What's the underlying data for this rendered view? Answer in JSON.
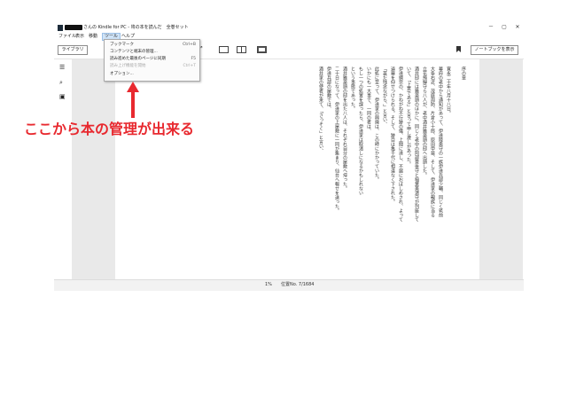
{
  "window": {
    "title": "さんの Kindle for PC - 将の本を読んだ　全巻セット",
    "controls": {
      "minimize": "－",
      "maximize": "▢",
      "close": "✕"
    }
  },
  "menubar": {
    "items": [
      "ファイル",
      "表示",
      "移動",
      "ツール",
      "ヘルプ"
    ],
    "active": "ツール"
  },
  "toolbar": {
    "library_button": "ライブラリ",
    "notebook_button": "ノートブックを表示",
    "view_icons": [
      "single-page-icon",
      "two-page-icon",
      "grid-view-icon"
    ],
    "bookmark_icon": "bookmark-icon"
  },
  "sidebar": {
    "icons": [
      "contents-icon",
      "search-icon",
      "notes-icon"
    ]
  },
  "tools_menu": {
    "items": [
      {
        "label": "ブックマーク",
        "shortcut": "Ctrl+B",
        "enabled": true
      },
      {
        "label": "コンテンツと端末の管理...",
        "shortcut": "",
        "enabled": true
      },
      {
        "label": "読み進めた最後のページに同期",
        "shortcut": "F5",
        "enabled": true
      },
      {
        "label": "読み上げ機能を開始",
        "shortcut": "Ctrl+T",
        "enabled": false
      },
      {
        "label": "オプション...",
        "shortcut": "",
        "enabled": true
      }
    ]
  },
  "book": {
    "chapter": "序の章",
    "columns": [
      "寛永二十年八月十八日。",
      "幕府の老中から通知があって、伊達陸奥守の一族伊達兵部少輔、同じく筑前",
      "大条右近、茂庭周防、片倉小十郎、原田甲斐、そして、伊達家の親族に当る",
      "立花飛騨守ら八人が、老中酒井雅楽頭の邸へ出頭した。",
      "酒井邸には雅楽頭のほかに、同じく老中の阿部豊後守と稲葉美濃守が列座して",
      "いて、「上意である」と言って申し渡しがあった。",
      "伊達綱宗の、かねがね不行跡の儀、上聞に達し、不届におぼしめされ、よって",
      "逼塞を仰せつけられる。そして、跡目は亀千代に相違なく下された。",
      "「甚だ残念ながら、」と言い、",
      "此処に至って、伊達家の興廃は、この時にかかっていた。",
      "いかにも一大事で、一同の者は、",
      "もし一つの処置を誤ったら、伊達家は取潰しになるかもしれない",
      "という事態であった。",
      "酒井雅楽頭の邸を出た八人は、それぞれ自分の屋敷へ帰った。",
      "二十日になって、伊達家の上屋敷に一同が集まり、仙台へ報せを送った。",
      "伊達兵部の屋敷では、",
      "酒井家の使者が来て、「さっそく」と言い、"
    ]
  },
  "status": {
    "percent": "1%",
    "location": "位置No. 7/1684"
  },
  "annotation": {
    "text": "ここから本の管理が出来る"
  }
}
